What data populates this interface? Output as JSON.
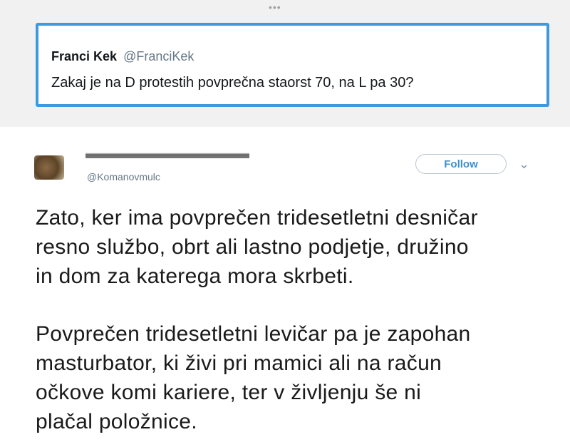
{
  "quoted": {
    "name": "Franci Kek",
    "handle": "@FranciKek",
    "text": "Zakaj je na D protestih povprečna staorst 70, na L pa 30?"
  },
  "tweet": {
    "handle": "@Komanovmulc",
    "follow_label": "Follow",
    "paragraph1_lines": [
      "Zato, ker ima povprečen tridesetletni desničar",
      "resno službo, obrt ali lastno podjetje, družino",
      "in dom za katerega mora skrbeti."
    ],
    "paragraph2_lines": [
      "Povprečen tridesetletni levičar pa je zapohan",
      "masturbator, ki živi pri mamici ali na račun",
      "očkove komi kariere, ter v življenju še ni",
      "plačal položnice."
    ]
  }
}
